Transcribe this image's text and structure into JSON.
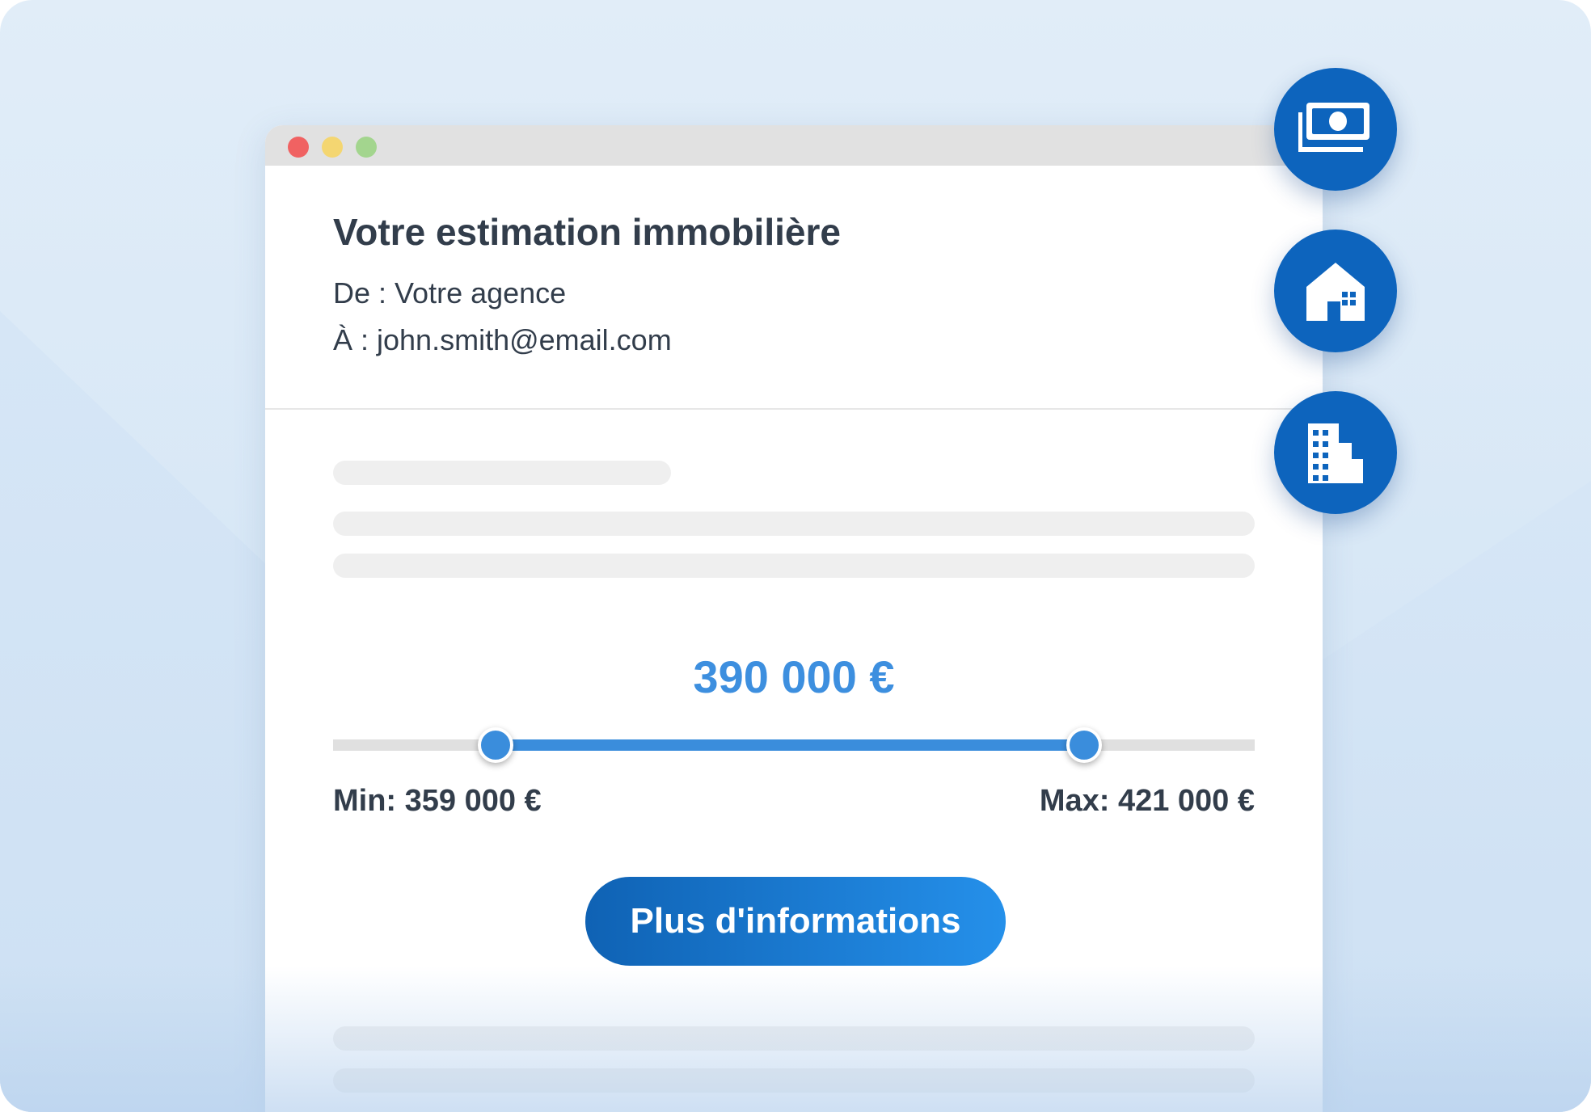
{
  "email": {
    "subject": "Votre estimation immobilière",
    "from_line": "De : Votre agence",
    "to_line": "À : john.smith@email.com"
  },
  "estimation": {
    "amount": "390 000 €",
    "min_label": "Min: 359 000 €",
    "max_label": "Max: 421 000 €",
    "min_value": 359000,
    "max_value": 421000
  },
  "cta": {
    "label": "Plus d'informations"
  },
  "side_actions": [
    {
      "icon": "money-icon"
    },
    {
      "icon": "house-icon"
    },
    {
      "icon": "building-icon"
    }
  ],
  "colors": {
    "accent": "#3a8ddc",
    "brand": "#0d64bd",
    "text": "#323d4b"
  }
}
